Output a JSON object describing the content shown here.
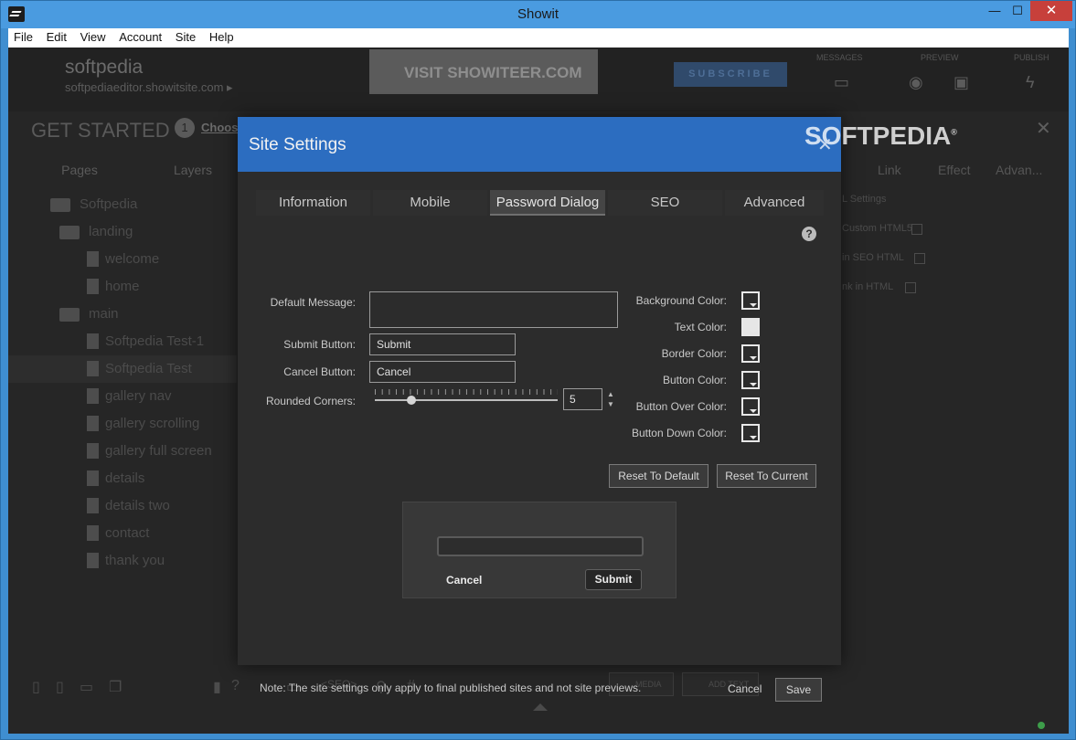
{
  "window": {
    "title": "Showit",
    "minimize": "—",
    "maximize": "☐",
    "close": "✕"
  },
  "menu": [
    "File",
    "Edit",
    "View",
    "Account",
    "Site",
    "Help"
  ],
  "background": {
    "site_name": "softpedia",
    "site_url": "softpediaeditor.showitsite.com ▸",
    "banner": "VISIT SHOWITEER.COM",
    "subscribe": "SUBSCRIBE",
    "top_labels": [
      "MESSAGES",
      "PREVIEW",
      "PUBLISH"
    ],
    "get_started": "GET STARTED",
    "step_number": "1",
    "choose": "Choos",
    "left_tabs": [
      "Pages",
      "Layers"
    ],
    "right_tabs": [
      "Link",
      "Effect",
      "Advan..."
    ],
    "right_settings": "L Settings",
    "right_rows": [
      "Custom HTML5",
      "in SEO HTML",
      "nk in HTML"
    ],
    "tree": [
      {
        "label": "Softpedia",
        "type": "folder"
      },
      {
        "label": "landing",
        "type": "folder"
      },
      {
        "label": "welcome",
        "type": "doc"
      },
      {
        "label": "home",
        "type": "doc"
      },
      {
        "label": "main",
        "type": "folder"
      },
      {
        "label": "Softpedia Test-1",
        "type": "doc"
      },
      {
        "label": "Softpedia Test",
        "type": "doc"
      },
      {
        "label": "gallery nav",
        "type": "doc"
      },
      {
        "label": "gallery scrolling",
        "type": "doc"
      },
      {
        "label": "gallery full screen",
        "type": "doc"
      },
      {
        "label": "details",
        "type": "doc"
      },
      {
        "label": "details two",
        "type": "doc"
      },
      {
        "label": "contact",
        "type": "doc"
      },
      {
        "label": "thank you",
        "type": "doc"
      }
    ],
    "bottom_media": "MEDIA",
    "bottom_add_text": "ADD TEXT",
    "bottom_seo": "<SEO>"
  },
  "dialog": {
    "title": "Site Settings",
    "watermark": "SOFTPEDIA",
    "watermark_mark": "®",
    "close": "✕",
    "tabs": [
      "Information",
      "Mobile",
      "Password Dialog",
      "SEO",
      "Advanced"
    ],
    "active_tab": "Password Dialog",
    "help": "?",
    "fields": {
      "default_message_label": "Default Message:",
      "default_message_value": "",
      "submit_button_label": "Submit Button:",
      "submit_button_value": "Submit",
      "cancel_button_label": "Cancel Button:",
      "cancel_button_value": "Cancel",
      "rounded_corners_label": "Rounded Corners:",
      "rounded_corners_value": "5"
    },
    "colors": [
      {
        "label": "Background Color:",
        "value": "#2c2c2c"
      },
      {
        "label": "Text Color:",
        "value": "#e6e6e6"
      },
      {
        "label": "Border Color:",
        "value": "#2c2c2c"
      },
      {
        "label": "Button Color:",
        "value": "#2c2c2c"
      },
      {
        "label": "Button Over Color:",
        "value": "#2c2c2c"
      },
      {
        "label": "Button Down Color:",
        "value": "#2c2c2c"
      }
    ],
    "reset_default": "Reset To Default",
    "reset_current": "Reset To Current",
    "preview": {
      "cancel": "Cancel",
      "submit": "Submit"
    },
    "note": "Note: The site settings only apply to final published sites and not site previews.",
    "cancel": "Cancel",
    "save": "Save"
  }
}
